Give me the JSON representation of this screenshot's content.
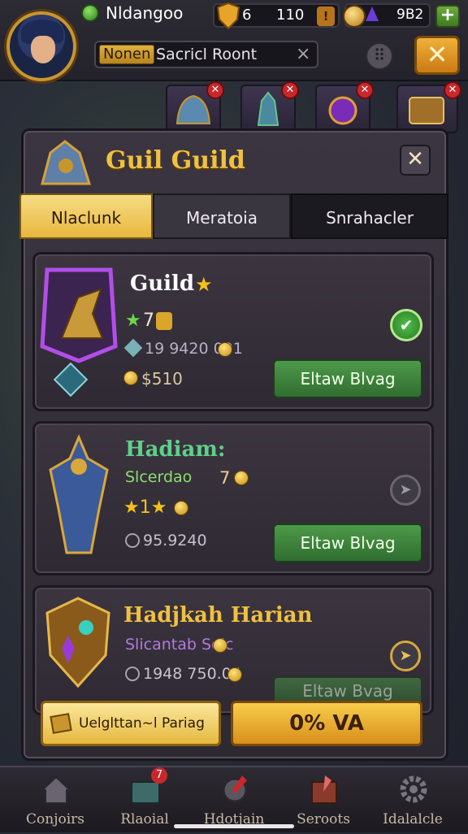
{
  "topbar": {
    "player_name": "Nldangoo",
    "shield_value": "6",
    "resource_value": "110",
    "small_badge": "!",
    "gem_value": "9B2",
    "plus_label": "+",
    "search_tag": "Nonen",
    "search_text": "Sacricl Roont",
    "search_clear": "×",
    "menu_label": "⠿",
    "close_label": "✕"
  },
  "banners": [
    {
      "icon": "helmet-icon"
    },
    {
      "icon": "knight-icon"
    },
    {
      "icon": "orb-icon"
    },
    {
      "icon": "crate-icon"
    }
  ],
  "modal": {
    "title": "Guil Guild",
    "close_label": "✕",
    "tabs": [
      {
        "label": "Nlaclunk",
        "active": true
      },
      {
        "label": "Meratoia",
        "active": false
      },
      {
        "label": "Snrahacler",
        "active": false
      }
    ]
  },
  "cards": [
    {
      "name": "Guild",
      "star": "★",
      "level": "7",
      "level_star": "★",
      "members": "19 9420 091",
      "coins": "$510",
      "button": "Eltaw Blvag",
      "check": "✔"
    },
    {
      "name": "Hadiam:",
      "subtitle": "Slcerdao",
      "sub_value": "7",
      "stars": "★1★",
      "points": "95.9240",
      "button": "Eltaw Blvag",
      "action": "➤"
    },
    {
      "name": "Hadjkah Harian",
      "subtitle": "Slicantab Selc",
      "points": "1948 750.05",
      "button": "Eltaw Bvag",
      "action": "➤"
    }
  ],
  "bottom_buttons": {
    "left_label": "Uelglttan~l Pariag",
    "right_label": "0% VA"
  },
  "nav": [
    {
      "label": "Conjoirs",
      "icon": "house-icon"
    },
    {
      "label": "Rlaoial",
      "icon": "chest-icon",
      "badge": "7"
    },
    {
      "label": "Hdotjain",
      "icon": "gear-sword-icon"
    },
    {
      "label": "Seroots",
      "icon": "book-icon"
    },
    {
      "label": "Idalalcle",
      "icon": "settings-icon"
    }
  ],
  "colors": {
    "gold": "#f0c040",
    "green": "#3f8a3c",
    "purple": "#9a3bd8",
    "panel": "#2e2933"
  }
}
